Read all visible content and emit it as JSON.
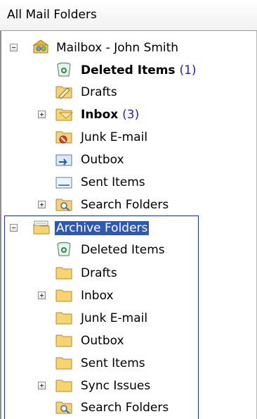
{
  "header": {
    "title": "All Mail Folders"
  },
  "mailbox": {
    "label": "Mailbox - John Smith",
    "folders": [
      {
        "label": "Deleted Items",
        "count": "(1)"
      },
      {
        "label": "Drafts"
      },
      {
        "label": "Inbox",
        "count": "(3)"
      },
      {
        "label": "Junk E-mail"
      },
      {
        "label": "Outbox"
      },
      {
        "label": "Sent Items"
      },
      {
        "label": "Search Folders"
      }
    ]
  },
  "archive": {
    "label": "Archive Folders",
    "folders": [
      {
        "label": "Deleted Items"
      },
      {
        "label": "Drafts"
      },
      {
        "label": "Inbox"
      },
      {
        "label": "Junk E-mail"
      },
      {
        "label": "Outbox"
      },
      {
        "label": "Sent Items"
      },
      {
        "label": "Sync Issues"
      },
      {
        "label": "Search Folders"
      }
    ]
  }
}
